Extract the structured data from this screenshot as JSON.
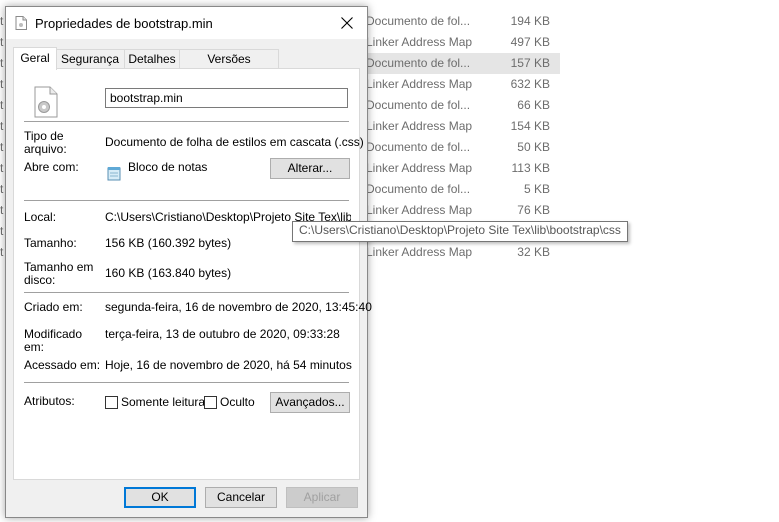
{
  "background_list": {
    "rows": [
      {
        "type": "Documento de fol...",
        "size": "194 KB",
        "selected": false
      },
      {
        "type": "Linker Address Map",
        "size": "497 KB",
        "selected": false
      },
      {
        "type": "Documento de fol...",
        "size": "157 KB",
        "selected": true
      },
      {
        "type": "Linker Address Map",
        "size": "632 KB",
        "selected": false
      },
      {
        "type": "Documento de fol...",
        "size": "66 KB",
        "selected": false
      },
      {
        "type": "Linker Address Map",
        "size": "154 KB",
        "selected": false
      },
      {
        "type": "Documento de fol...",
        "size": "50 KB",
        "selected": false
      },
      {
        "type": "Linker Address Map",
        "size": "113 KB",
        "selected": false
      },
      {
        "type": "Documento de fol...",
        "size": "5 KB",
        "selected": false
      },
      {
        "type": "Linker Address Map",
        "size": "76 KB",
        "selected": false
      },
      {
        "type": "",
        "size": "",
        "selected": false
      },
      {
        "type": "Linker Address Map",
        "size": "32 KB",
        "selected": false
      }
    ],
    "left_fragment": "t"
  },
  "dialog": {
    "title": "Propriedades de bootstrap.min",
    "tabs": [
      "Geral",
      "Segurança",
      "Detalhes",
      "Versões Anteriores"
    ],
    "active_tab": "Geral",
    "file_name": "bootstrap.min",
    "fields": {
      "type_label": "Tipo de\narquivo:",
      "type_value": "Documento de folha de estilos em cascata (.css)",
      "opens_with_label": "Abre com:",
      "opens_with_value": "Bloco de notas",
      "change_button": "Alterar...",
      "location_label": "Local:",
      "location_value": "C:\\Users\\Cristiano\\Desktop\\Projeto Site Tex\\lib\\boo",
      "size_label": "Tamanho:",
      "size_value": "156 KB (160.392 bytes)",
      "size_on_disk_label": "Tamanho em\ndisco:",
      "size_on_disk_value": "160 KB (163.840 bytes)",
      "created_label": "Criado em:",
      "created_value": "segunda-feira, 16 de novembro de 2020, 13:45:40",
      "modified_label": "Modificado\nem:",
      "modified_value": "terça-feira, 13 de outubro de 2020, 09:33:28",
      "accessed_label": "Acessado em:",
      "accessed_value": "Hoje, 16 de novembro de 2020, há 54 minutos",
      "attributes_label": "Atributos:",
      "readonly_label": "Somente leitura",
      "hidden_label": "Oculto",
      "advanced_button": "Avançados..."
    },
    "buttons": {
      "ok": "OK",
      "cancel": "Cancelar",
      "apply": "Aplicar"
    }
  },
  "tooltip": "C:\\Users\\Cristiano\\Desktop\\Projeto Site Tex\\lib\\bootstrap\\css",
  "icons": {
    "title": "css-file-icon",
    "file": "css-file-gear-icon",
    "notepad": "notepad-icon",
    "close": "close-icon"
  },
  "colors": {
    "accent": "#0078d7",
    "selected_row": "#e5e5e5"
  }
}
